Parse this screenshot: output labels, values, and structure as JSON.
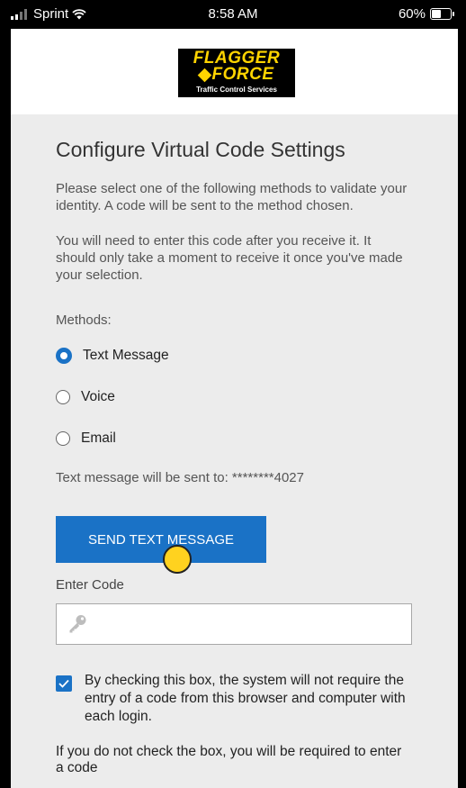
{
  "status_bar": {
    "carrier": "Sprint",
    "time": "8:58 AM",
    "battery": "60%",
    "battery_level": 0.6
  },
  "logo": {
    "line1": "FLAGGER",
    "line2": "FORCE",
    "tagline": "Traffic Control Services",
    "brand_color": "#ffd400"
  },
  "page": {
    "title": "Configure Virtual Code Settings",
    "instructions": "Please select one of the following methods to validate your identity. A code will be sent to the method chosen.",
    "note": "You will need to enter this code after you receive it. It should only take a moment to receive it once you've made your selection.",
    "methods_label": "Methods:",
    "methods": [
      {
        "label": "Text Message",
        "selected": true
      },
      {
        "label": "Voice",
        "selected": false
      },
      {
        "label": "Email",
        "selected": false
      }
    ],
    "sent_to": "Text message will be sent to: ********4027",
    "send_button": "SEND TEXT MESSAGE",
    "enter_code_label": "Enter Code",
    "code_value": "",
    "remember_checked": true,
    "remember_text": "By checking this box, the system will not require the entry of a code from this browser and computer with each login.",
    "cut_off_text": "If you do not check the box, you will be required to enter a code"
  },
  "colors": {
    "accent": "#1a72c6",
    "page_bg": "#ececec"
  }
}
